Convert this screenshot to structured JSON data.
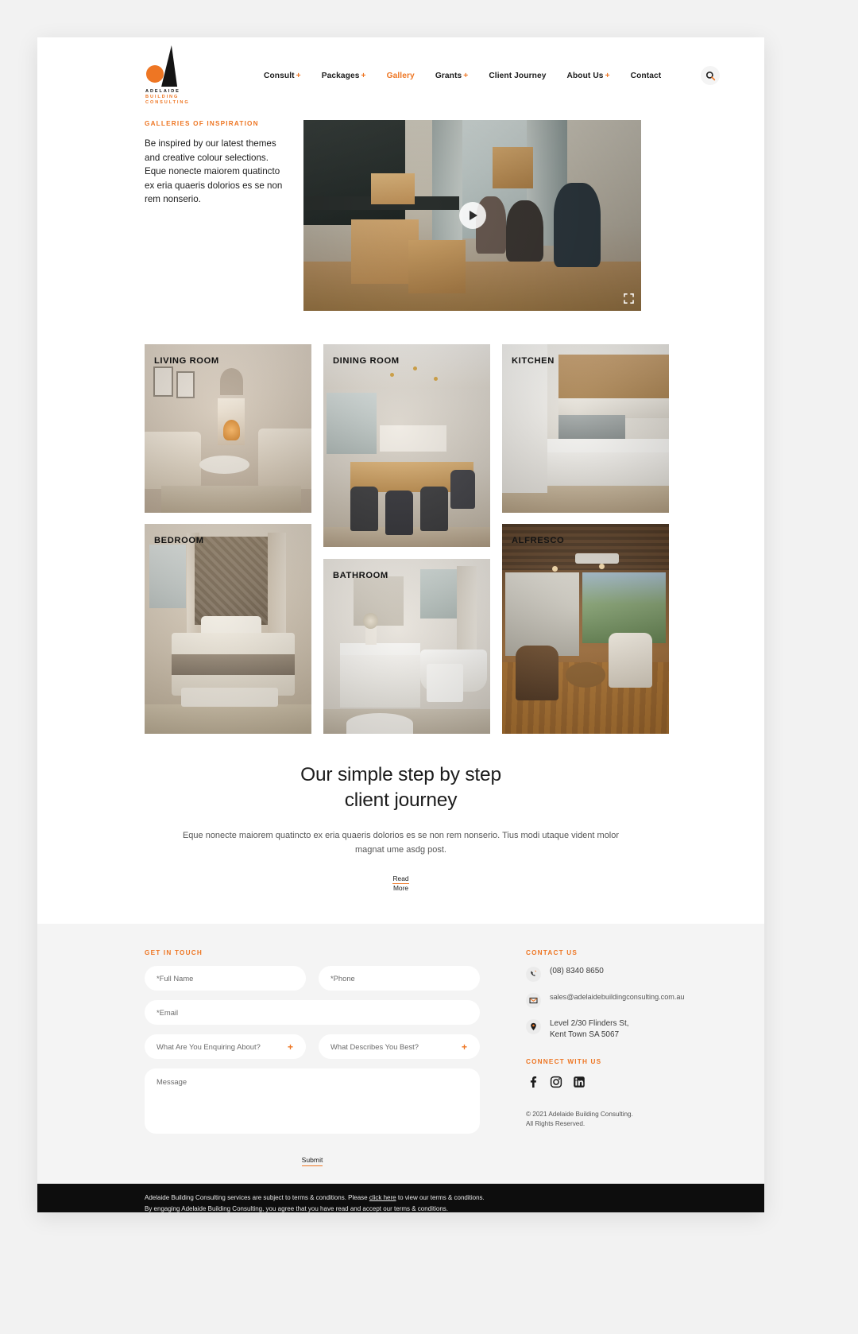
{
  "header": {
    "logo": {
      "line1": "ADELAIDE",
      "line2": "BUILDING",
      "line3": "CONSULTING"
    },
    "nav": [
      {
        "label": "Consult",
        "plus": "+",
        "active": false
      },
      {
        "label": "Packages",
        "plus": "+",
        "active": false
      },
      {
        "label": "Gallery",
        "plus": "",
        "active": true
      },
      {
        "label": "Grants",
        "plus": "+",
        "active": false
      },
      {
        "label": "Client Journey",
        "plus": "",
        "active": false
      },
      {
        "label": "About Us",
        "plus": "+",
        "active": false
      },
      {
        "label": "Contact",
        "plus": "",
        "active": false
      }
    ],
    "search_icon": "search-icon"
  },
  "hero": {
    "eyebrow": "GALLERIES OF INSPIRATION",
    "copy": "Be inspired by our latest themes and creative colour selections. Eque nonecte maiorem quatincto ex eria quaeris dolorios es se non rem nonserio.",
    "play_icon": "play-icon",
    "fullscreen_icon": "fullscreen-icon"
  },
  "gallery": {
    "tiles": [
      {
        "label": "LIVING ROOM"
      },
      {
        "label": "DINING ROOM"
      },
      {
        "label": "KITCHEN"
      },
      {
        "label": "BEDROOM"
      },
      {
        "label": "BATHROOM"
      },
      {
        "label": "ALFRESCO"
      }
    ]
  },
  "journey": {
    "title_line1": "Our simple step by step",
    "title_line2": "client journey",
    "body": "Eque nonecte maiorem quatincto ex eria quaeris dolorios es se non rem nonserio. Tius modi utaque vident molor magnat ume asdg post.",
    "cta_line1": "Read",
    "cta_line2": "More"
  },
  "footer": {
    "form_heading": "GET IN TOUCH",
    "fields": {
      "full_name": "*Full Name",
      "phone": "*Phone",
      "email": "*Email",
      "enquiring": "What Are You Enquiring About?",
      "describes": "What Describes You Best?",
      "message": "Message",
      "plus": "+"
    },
    "submit_label": "Submit",
    "contact_heading": "CONTACT US",
    "phone": "(08) 8340 8650",
    "email": "sales@adelaidebuildingconsulting.com.au",
    "address_line1": "Level 2/30 Flinders St,",
    "address_line2": "Kent Town SA 5067",
    "connect_heading": "CONNECT WITH US",
    "socials": [
      {
        "name": "facebook-icon",
        "glyph": "f"
      },
      {
        "name": "instagram-icon",
        "glyph": ""
      },
      {
        "name": "linkedin-icon",
        "glyph": "in"
      }
    ],
    "copyright_line1": "© 2021 Adelaide Building Consulting.",
    "copyright_line2": "All Rights Reserved."
  },
  "terms": {
    "line1_before": "Adelaide Building Consulting services are subject to terms & conditions. Please ",
    "link": "click here",
    "line1_after": " to view our terms & conditions.",
    "line2": "By engaging Adelaide Building Consulting, you agree that you have read and accept our terms & conditions."
  },
  "colors": {
    "accent": "#ee7623",
    "text": "#1c1c1c",
    "page_bg": "#f2f2f2",
    "footer_bg": "#f4f4f4",
    "terms_bg": "#0d0d0d"
  }
}
